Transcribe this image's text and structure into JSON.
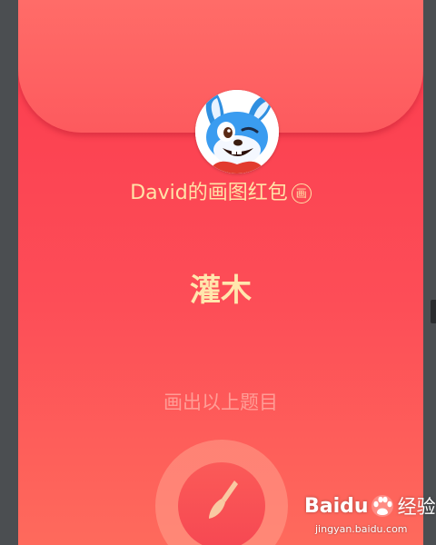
{
  "envelope": {
    "sender_label": "David的画图红包",
    "draw_badge": "画",
    "topic_word": "灌木",
    "hint": "画出以上题目",
    "colors": {
      "envelope_top": "#fb3b4e",
      "envelope_bottom": "#fe6a5c",
      "flap": "#ff6c68",
      "gold_text": "#ffe3a8",
      "hint_text": "#ff9d96",
      "backdrop": "#4b4e51"
    },
    "avatar_icon": "blue-cartoon-rabbit-avatar",
    "draw_button_icon": "paintbrush-icon"
  },
  "watermark": {
    "brand": "Baidu",
    "brand_cn": "经验",
    "url": "jingyan.baidu.com"
  }
}
